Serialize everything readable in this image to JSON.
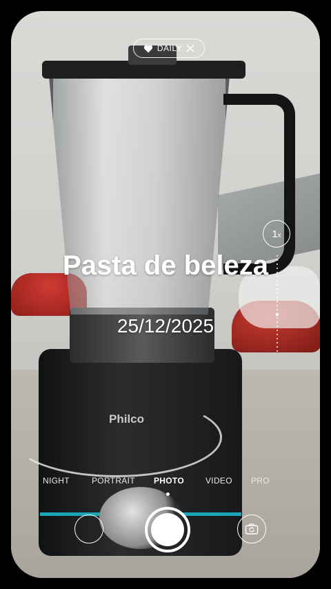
{
  "daily_badge": {
    "label": "DAILY",
    "icon": "heart-icon",
    "close_icon": "close-icon"
  },
  "overlay": {
    "title": "Pasta de beleza",
    "date": "25/12/2025"
  },
  "zoom": {
    "value": "1",
    "unit": "x"
  },
  "modes": [
    {
      "label": "NIGHT",
      "active": false
    },
    {
      "label": "PORTRAIT",
      "active": false
    },
    {
      "label": "PHOTO",
      "active": true
    },
    {
      "label": "VIDEO",
      "active": false
    },
    {
      "label": "PRO",
      "active": false
    }
  ],
  "controls": {
    "gallery_icon": "gallery-thumbnail-icon",
    "shutter_icon": "shutter-icon",
    "flip_icon": "camera-flip-icon"
  },
  "scene": {
    "brand_label": "Philco"
  },
  "colors": {
    "overlay_text": "#ffffff",
    "accent_cyan": "#1aa6b7"
  }
}
